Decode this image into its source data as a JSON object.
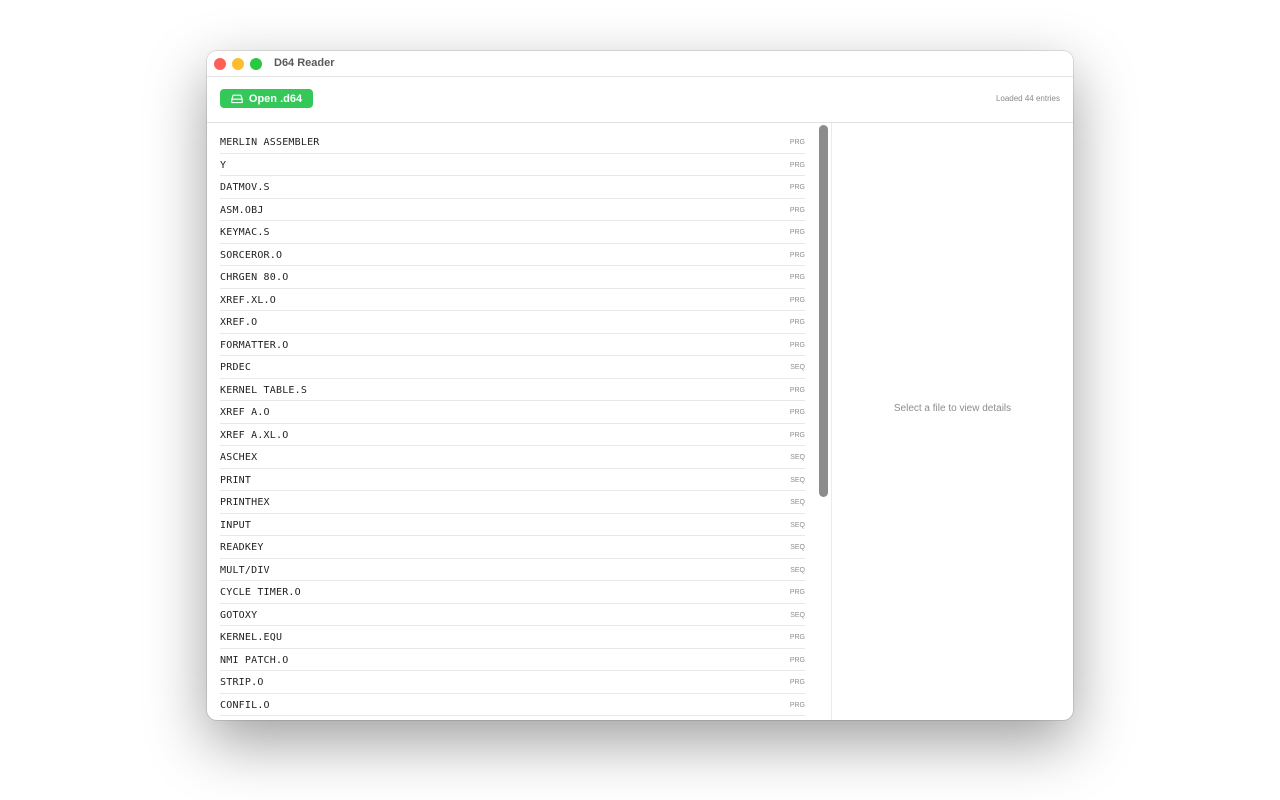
{
  "window": {
    "title": "D64 Reader"
  },
  "toolbar": {
    "open_label": "Open .d64",
    "open_icon": "drive-icon",
    "status": "Loaded 44 entries"
  },
  "colors": {
    "accent": "#34c759"
  },
  "files": [
    {
      "name": "MERLIN ASSEMBLER",
      "type": "PRG"
    },
    {
      "name": "Y",
      "type": "PRG"
    },
    {
      "name": "DATMOV.S",
      "type": "PRG"
    },
    {
      "name": "ASM.OBJ",
      "type": "PRG"
    },
    {
      "name": "KEYMAC.S",
      "type": "PRG"
    },
    {
      "name": "SORCEROR.O",
      "type": "PRG"
    },
    {
      "name": "CHRGEN 80.O",
      "type": "PRG"
    },
    {
      "name": "XREF.XL.O",
      "type": "PRG"
    },
    {
      "name": "XREF.O",
      "type": "PRG"
    },
    {
      "name": "FORMATTER.O",
      "type": "PRG"
    },
    {
      "name": "PRDEC",
      "type": "SEQ"
    },
    {
      "name": "KERNEL TABLE.S",
      "type": "PRG"
    },
    {
      "name": "XREF A.O",
      "type": "PRG"
    },
    {
      "name": "XREF A.XL.O",
      "type": "PRG"
    },
    {
      "name": "ASCHEX",
      "type": "SEQ"
    },
    {
      "name": "PRINT",
      "type": "SEQ"
    },
    {
      "name": "PRINTHEX",
      "type": "SEQ"
    },
    {
      "name": "INPUT",
      "type": "SEQ"
    },
    {
      "name": "READKEY",
      "type": "SEQ"
    },
    {
      "name": "MULT/DIV",
      "type": "SEQ"
    },
    {
      "name": "CYCLE TIMER.O",
      "type": "PRG"
    },
    {
      "name": "GOTOXY",
      "type": "SEQ"
    },
    {
      "name": "KERNEL.EQU",
      "type": "PRG"
    },
    {
      "name": "NMI PATCH.O",
      "type": "PRG"
    },
    {
      "name": "STRIP.O",
      "type": "PRG"
    },
    {
      "name": "CONFIL.O",
      "type": "PRG"
    }
  ],
  "detail": {
    "empty_message": "Select a file to view details"
  }
}
